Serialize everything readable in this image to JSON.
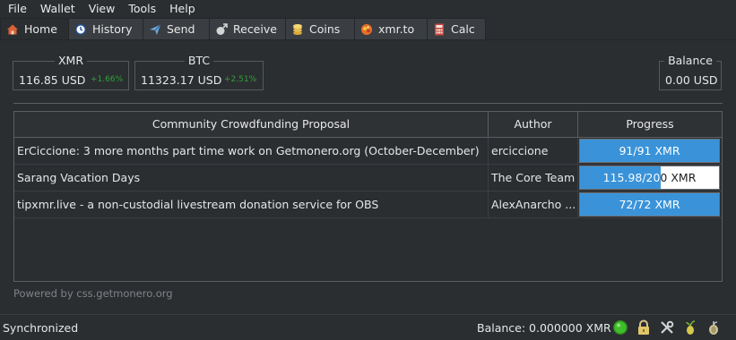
{
  "menu": [
    "File",
    "Wallet",
    "View",
    "Tools",
    "Help"
  ],
  "tabs": [
    {
      "label": "Home",
      "icon": "home-icon",
      "active": true
    },
    {
      "label": "History",
      "icon": "history-icon"
    },
    {
      "label": "Send",
      "icon": "send-icon"
    },
    {
      "label": "Receive",
      "icon": "receive-icon"
    },
    {
      "label": "Coins",
      "icon": "coins-icon"
    },
    {
      "label": "xmr.to",
      "icon": "xmrto-icon"
    },
    {
      "label": "Calc",
      "icon": "calc-icon"
    }
  ],
  "prices": {
    "xmr": {
      "label": "XMR",
      "value": "116.85 USD",
      "change": "+1.66%"
    },
    "btc": {
      "label": "BTC",
      "value": "11323.17 USD",
      "change": "+2.51%"
    },
    "balance": {
      "label": "Balance",
      "value": "0.00 USD"
    }
  },
  "table": {
    "headers": [
      "Community Crowdfunding Proposal",
      "Author",
      "Progress"
    ],
    "rows": [
      {
        "proposal": "ErCiccione: 3 more months part time work on Getmonero.org (October-December)",
        "author": "erciccione",
        "progress": "91/91 XMR",
        "fraction": 1.0
      },
      {
        "proposal": "Sarang Vacation Days",
        "author": "The Core Team",
        "progress": "115.98/200 XMR",
        "fraction": 0.5799
      },
      {
        "proposal": "tipxmr.live - a non-custodial livestream donation service for OBS",
        "author": "AlexAnarcho ...",
        "progress": "72/72 XMR",
        "fraction": 1.0
      }
    ]
  },
  "powered_by": "Powered by css.getmonero.org",
  "status": {
    "sync": "Synchronized",
    "balance": "Balance: 0.000000 XMR",
    "icons": [
      "connection-status-icon",
      "lock-icon",
      "settings-icon",
      "seed-icon",
      "tor-icon"
    ]
  },
  "colors": {
    "accent": "#3a93d9",
    "positive": "#2fa13a",
    "connected": "#3fbf2a"
  }
}
